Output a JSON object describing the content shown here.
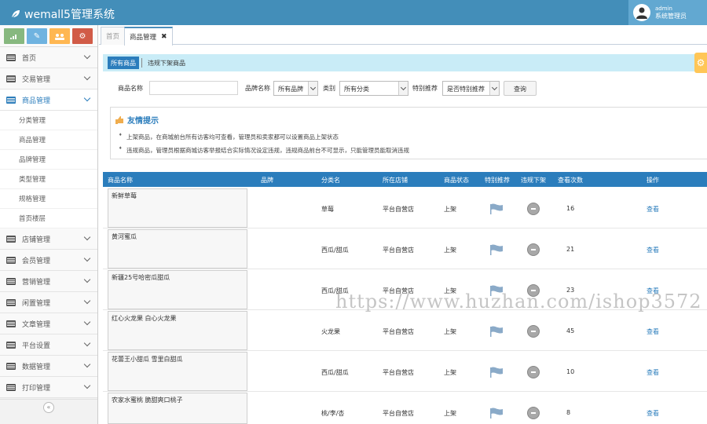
{
  "header": {
    "brand": "wemall5管理系统",
    "user_name": "admin",
    "user_role": "系统管理员"
  },
  "shortcuts": [
    {
      "icon": "signal-icon",
      "color": "#87b87f"
    },
    {
      "icon": "pencil-icon",
      "color": "#6fb3e0"
    },
    {
      "icon": "users-icon",
      "color": "#ffb752"
    },
    {
      "icon": "cogs-icon",
      "color": "#d15b47"
    }
  ],
  "sidebar": {
    "top_items": [
      {
        "label": "首页"
      },
      {
        "label": "交易管理"
      },
      {
        "label": "商品管理"
      }
    ],
    "sub_items": [
      {
        "label": "分类管理"
      },
      {
        "label": "商品管理"
      },
      {
        "label": "品牌管理"
      },
      {
        "label": "类型管理"
      },
      {
        "label": "规格管理"
      },
      {
        "label": "首页楼层"
      }
    ],
    "bottom_items": [
      {
        "label": "店铺管理"
      },
      {
        "label": "会员管理"
      },
      {
        "label": "营销管理"
      },
      {
        "label": "闲置管理"
      },
      {
        "label": "文章管理"
      },
      {
        "label": "平台设置"
      },
      {
        "label": "数据管理"
      },
      {
        "label": "打印管理"
      }
    ],
    "collapse_glyph": "«"
  },
  "tabs": [
    {
      "label": "首页"
    },
    {
      "label": "商品管理",
      "close": "✖"
    }
  ],
  "filter_tabs": {
    "all": "所有商品",
    "violations": "违规下架商品"
  },
  "search": {
    "name_label": "商品名称",
    "name_value": "",
    "brand_label": "品牌名称",
    "brand_value": "所有品牌",
    "category_label": "类别",
    "category_value": "所有分类",
    "special_label": "特别推荐",
    "special_value": "是否特别推荐",
    "query_button": "查询"
  },
  "tips": {
    "title": "友情提示",
    "lines": [
      "上架商品，在商城前台所有访客均可查看，管理员和卖家都可以设置商品上架状态",
      "违规商品，管理员根据商城访客举报结合实际情况设定违规，违规商品前台不可显示，只能管理员能取消违规"
    ]
  },
  "table": {
    "headers": [
      "商品名称",
      "品牌",
      "分类名",
      "所在店铺",
      "商品状态",
      "特别推荐",
      "违规下架",
      "查看次数",
      "操作"
    ],
    "rows": [
      {
        "name": "新鲜草莓",
        "brand": "",
        "category": "草莓",
        "store": "平台自营店",
        "status": "上架",
        "views": "16",
        "action": "查看"
      },
      {
        "name": "黄河蜜瓜",
        "brand": "",
        "category": "西瓜/甜瓜",
        "store": "平台自营店",
        "status": "上架",
        "views": "21",
        "action": "查看"
      },
      {
        "name": "新疆25号哈密瓜甜瓜",
        "brand": "",
        "category": "西瓜/甜瓜",
        "store": "平台自营店",
        "status": "上架",
        "views": "23",
        "action": "查看"
      },
      {
        "name": "红心火龙果 白心火龙果",
        "brand": "",
        "category": "火龙果",
        "store": "平台自营店",
        "status": "上架",
        "views": "45",
        "action": "查看"
      },
      {
        "name": "花蕾王小甜瓜 雪里白甜瓜",
        "brand": "",
        "category": "西瓜/甜瓜",
        "store": "平台自营店",
        "status": "上架",
        "views": "10",
        "action": "查看"
      },
      {
        "name": "农家水蜜桃 脆甜爽口桃子",
        "brand": "",
        "category": "桃/李/杏",
        "store": "平台自营店",
        "status": "上架",
        "views": "8",
        "action": "查看"
      }
    ]
  },
  "watermark": "https://www.huzhan.com/ishop3572",
  "colors": {
    "header": "#438eb9",
    "accent": "#2b7dbc",
    "filter_bar": "#c9ecf7",
    "settings": "#ffc657"
  }
}
